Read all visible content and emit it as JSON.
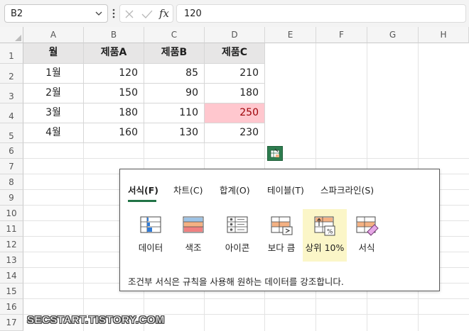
{
  "formula_bar": {
    "name_box": "B2",
    "fx_label": "fx",
    "formula_value": "120"
  },
  "columns": [
    "A",
    "B",
    "C",
    "D",
    "E",
    "F",
    "G",
    "H"
  ],
  "rows": [
    "1",
    "2",
    "3",
    "4",
    "5",
    "6",
    "7",
    "8",
    "9",
    "10",
    "11",
    "12",
    "13",
    "14",
    "15",
    "16",
    "17"
  ],
  "table": {
    "headers": [
      "월",
      "제품A",
      "제품B",
      "제품C"
    ],
    "rows": [
      [
        "1월",
        "120",
        "85",
        "210"
      ],
      [
        "2월",
        "150",
        "90",
        "180"
      ],
      [
        "3월",
        "180",
        "110",
        "250"
      ],
      [
        "4월",
        "160",
        "130",
        "230"
      ]
    ]
  },
  "colors": {
    "highlight_fill": "#ffc7ce",
    "highlight_text": "#9c0006",
    "header_fill": "#e7e6e6",
    "accent_green": "#217346",
    "selected_option_fill": "#fbf6c8"
  },
  "quick_analysis": {
    "button_icon": "quick-analysis-icon",
    "tabs": [
      {
        "label": "서식(F)",
        "active": true
      },
      {
        "label": "차트(C)",
        "active": false
      },
      {
        "label": "합계(O)",
        "active": false
      },
      {
        "label": "테이블(T)",
        "active": false
      },
      {
        "label": "스파크라인(S)",
        "active": false
      }
    ],
    "options": [
      {
        "label": "데이터",
        "icon": "data-bar-icon"
      },
      {
        "label": "색조",
        "icon": "color-scale-icon"
      },
      {
        "label": "아이콘",
        "icon": "icon-set-icon"
      },
      {
        "label": "보다 큼",
        "icon": "greater-than-icon"
      },
      {
        "label": "상위 10%",
        "icon": "top-10-percent-icon",
        "selected": true
      },
      {
        "label": "서식",
        "icon": "clear-format-icon"
      }
    ],
    "description": "조건부 서식은 규칙을 사용해 원하는 데이터를 강조합니다."
  },
  "watermark": "SECSTART.TISTORY.COM"
}
